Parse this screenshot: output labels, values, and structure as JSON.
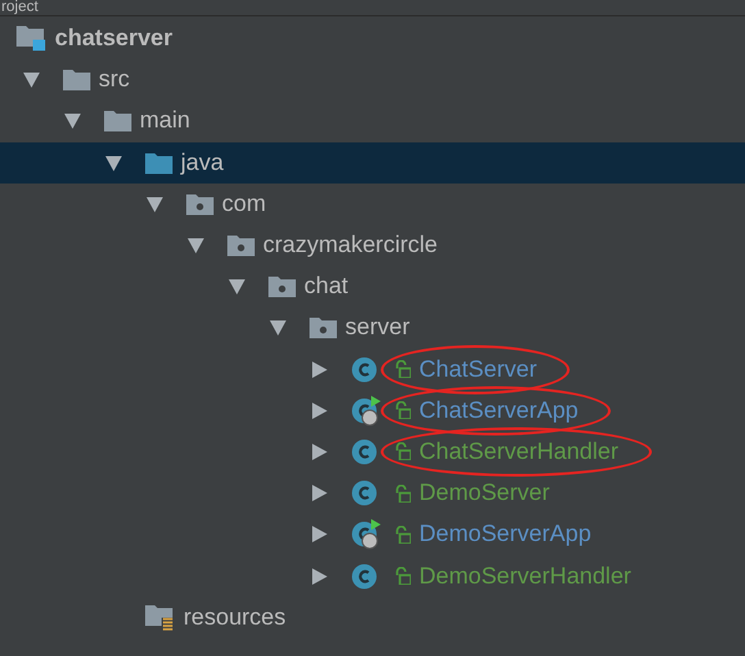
{
  "panel": {
    "title": "roject"
  },
  "tree": [
    {
      "label": "chatserver",
      "kind": "module",
      "children": [
        {
          "label": "src",
          "kind": "folder",
          "expanded": true,
          "selected": false,
          "children": [
            {
              "label": "main",
              "kind": "folder",
              "expanded": true,
              "selected": false,
              "children": [
                {
                  "label": "java",
                  "kind": "source",
                  "expanded": true,
                  "selected": true,
                  "children": [
                    {
                      "label": "com",
                      "kind": "package",
                      "expanded": true,
                      "selected": false,
                      "children": [
                        {
                          "label": "crazymakercircle",
                          "kind": "package",
                          "expanded": true,
                          "selected": false,
                          "children": [
                            {
                              "label": "chat",
                              "kind": "package",
                              "expanded": true,
                              "selected": false,
                              "children": [
                                {
                                  "label": "server",
                                  "kind": "package",
                                  "expanded": true,
                                  "selected": false,
                                  "children": [
                                    {
                                      "label": "ChatServer",
                                      "kind": "class",
                                      "expanded": false,
                                      "selected": false,
                                      "app": false,
                                      "modified": true,
                                      "circled": true
                                    },
                                    {
                                      "label": "ChatServerApp",
                                      "kind": "class",
                                      "expanded": false,
                                      "selected": false,
                                      "app": true,
                                      "modified": true,
                                      "circled": true
                                    },
                                    {
                                      "label": "ChatServerHandler",
                                      "kind": "class",
                                      "expanded": false,
                                      "selected": false,
                                      "app": false,
                                      "modified": false,
                                      "circled": true
                                    },
                                    {
                                      "label": "DemoServer",
                                      "kind": "class",
                                      "expanded": false,
                                      "selected": false,
                                      "app": false,
                                      "modified": false,
                                      "circled": false
                                    },
                                    {
                                      "label": "DemoServerApp",
                                      "kind": "class",
                                      "expanded": false,
                                      "selected": false,
                                      "app": true,
                                      "modified": true,
                                      "circled": false
                                    },
                                    {
                                      "label": "DemoServerHandler",
                                      "kind": "class",
                                      "expanded": false,
                                      "selected": false,
                                      "app": false,
                                      "modified": false,
                                      "circled": false
                                    }
                                  ]
                                }
                              ]
                            }
                          ]
                        }
                      ]
                    }
                  ]
                },
                {
                  "label": "resources",
                  "kind": "resources",
                  "selected": false
                }
              ]
            }
          ]
        }
      ]
    }
  ]
}
